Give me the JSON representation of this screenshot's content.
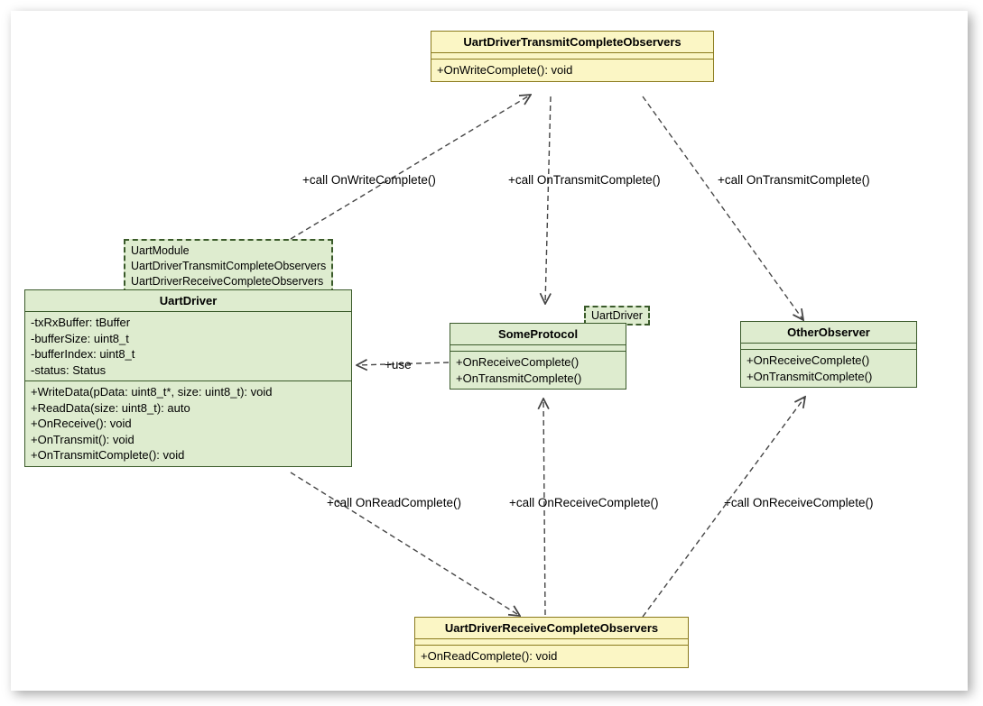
{
  "interfaces": {
    "transmit": {
      "name": "UartDriverTransmitCompleteObservers",
      "methods": [
        "+OnWriteComplete(): void"
      ]
    },
    "receive": {
      "name": "UartDriverReceiveCompleteObservers",
      "methods": [
        "+OnReadComplete(): void"
      ]
    }
  },
  "classes": {
    "uart_driver": {
      "name": "UartDriver",
      "template_params": [
        "UartModule",
        "UartDriverTransmitCompleteObservers",
        "UartDriverReceiveCompleteObservers"
      ],
      "attributes": [
        "-txRxBuffer: tBuffer",
        "-bufferSize: uint8_t",
        "-bufferIndex: uint8_t",
        "-status: Status"
      ],
      "operations": [
        "+WriteData(pData: uint8_t*, size: uint8_t): void",
        "+ReadData(size: uint8_t): auto",
        "+OnReceive(): void",
        "+OnTransmit(): void",
        "+OnTransmitComplete(): void"
      ]
    },
    "some_protocol": {
      "name": "SomeProtocol",
      "template_params": [
        "UartDriver"
      ],
      "operations": [
        "+OnReceiveComplete()",
        "+OnTransmitComplete()"
      ]
    },
    "other_observer": {
      "name": "OtherObserver",
      "operations": [
        "+OnReceiveComplete()",
        "+OnTransmitComplete()"
      ]
    }
  },
  "labels": {
    "use": "+use",
    "call_on_write_complete": "+call OnWriteComplete()",
    "call_on_transmit_complete_1": "+call  OnTransmitComplete()",
    "call_on_transmit_complete_2": "+call  OnTransmitComplete()",
    "call_on_read_complete": "+call OnReadComplete()",
    "call_on_receive_complete_1": "+call OnReceiveComplete()",
    "call_on_receive_complete_2": "+call OnReceiveComplete()"
  }
}
